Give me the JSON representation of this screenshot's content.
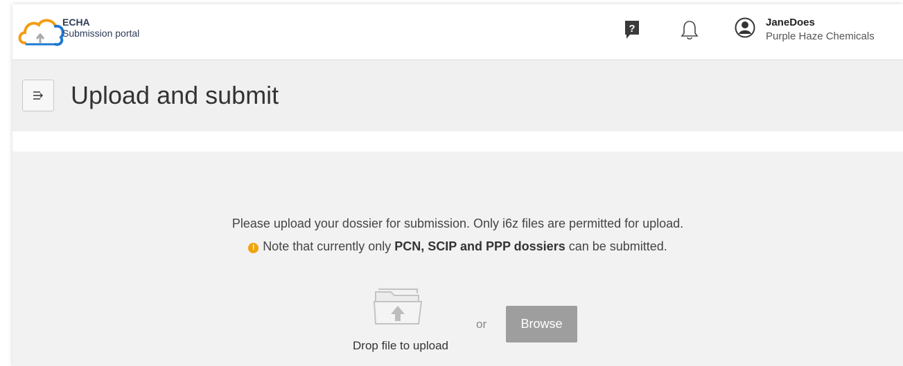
{
  "brand": {
    "name": "ECHA",
    "product": "Submission portal",
    "colors": {
      "orange": "#f39c12",
      "blue": "#1f78d1",
      "gray": "#a9a9a9"
    }
  },
  "header": {
    "help_icon": "help-question-icon",
    "notifications_icon": "bell-icon",
    "user": {
      "name": "JaneDoes",
      "organisation": "Purple Haze Chemicals",
      "avatar_icon": "user-avatar-icon"
    }
  },
  "page": {
    "menu_icon": "menu-toggle-icon",
    "title": "Upload and submit"
  },
  "upload": {
    "instructions": "Please upload your dossier for submission. Only i6z files are permitted for upload.",
    "note": {
      "icon": "warning-icon",
      "icon_color": "#f0a30a",
      "prefix": "Note that currently only ",
      "emphasis": "PCN, SCIP and PPP dossiers",
      "suffix": " can be submitted."
    },
    "drop_icon": "folder-upload-icon",
    "drop_label": "Drop file to upload",
    "or_text": "or",
    "browse_label": "Browse"
  }
}
